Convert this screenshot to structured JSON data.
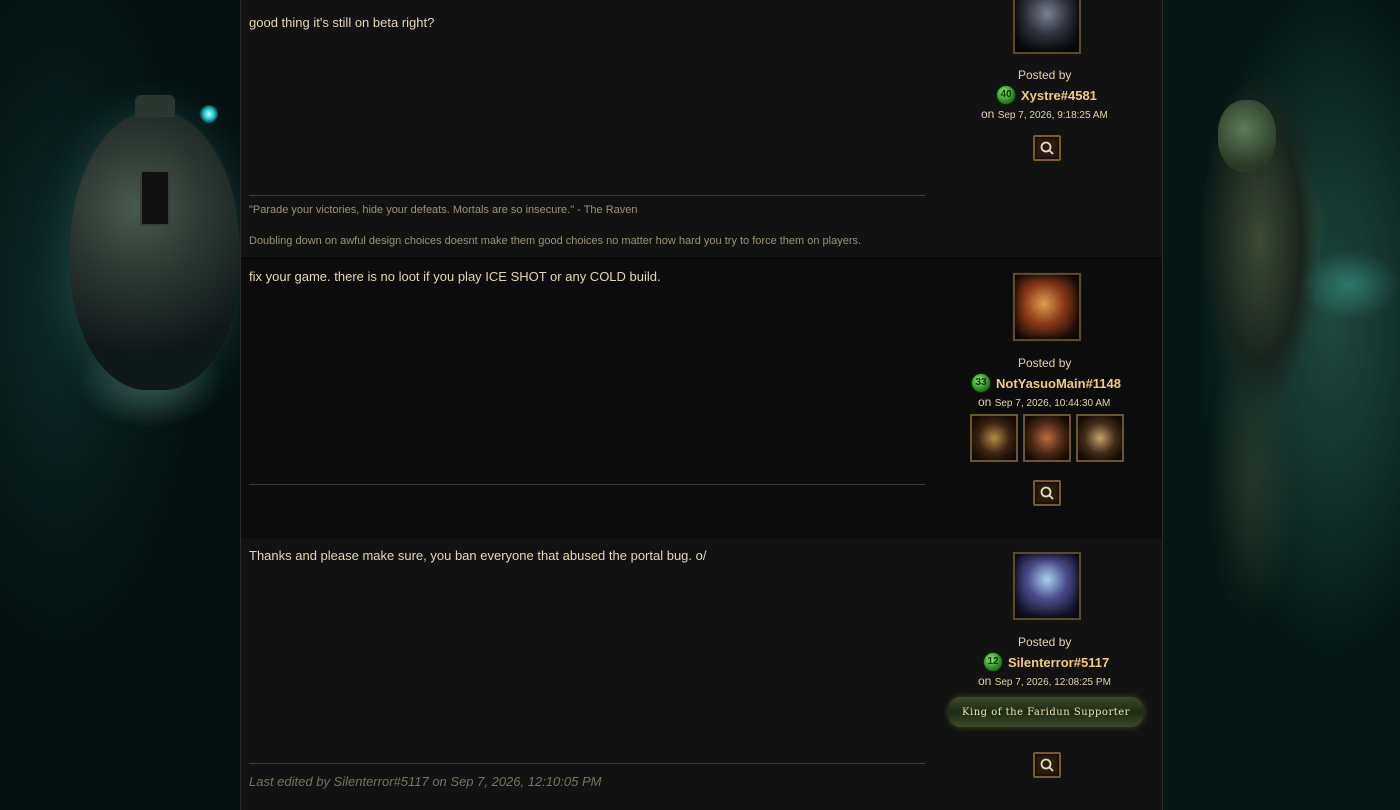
{
  "posts": [
    {
      "body": "good thing it's still on beta right?",
      "signature_lines": [
        "\"Parade your victories, hide your defeats. Mortals are so insecure.\" - The Raven",
        "Doubling down on awful design choices doesnt make them good choices no matter how hard you try to force them on players."
      ],
      "posted_by_label": "Posted by",
      "level": "40",
      "author": "Xystre#4581",
      "on_label": "on",
      "date": "Sep 7, 2026, 9:18:25 AM",
      "avatar_icon": "dark-armored-knight-avatar",
      "quote_icon": "search-icon"
    },
    {
      "body": "fix your game. there is no loot if you play ICE SHOT or any COLD build.",
      "posted_by_label": "Posted by",
      "level": "33",
      "author": "NotYasuoMain#1148",
      "on_label": "on",
      "date": "Sep 7, 2026, 10:44:30 AM",
      "avatar_icon": "winged-helmet-warrior-avatar",
      "badges": [
        "dragon-badge-icon",
        "sigil-badge-icon",
        "shield-badge-icon"
      ],
      "quote_icon": "search-icon"
    },
    {
      "body": "Thanks and please make sure, you ban everyone that abused the portal bug. o/",
      "edited_note": "Last edited by Silenterror#5117 on Sep 7, 2026, 12:10:05 PM",
      "posted_by_label": "Posted by",
      "level": "12",
      "author": "Silenterror#5117",
      "on_label": "on",
      "date": "Sep 7, 2026, 12:08:25 PM",
      "avatar_icon": "hooded-witch-avatar",
      "supporter_badge": "King of the Faridun Supporter",
      "quote_icon": "search-icon"
    }
  ],
  "colors": {
    "author_name": "#f2cc7a",
    "body_text": "#e4d7b6",
    "level_badge": "#4fb33a"
  }
}
